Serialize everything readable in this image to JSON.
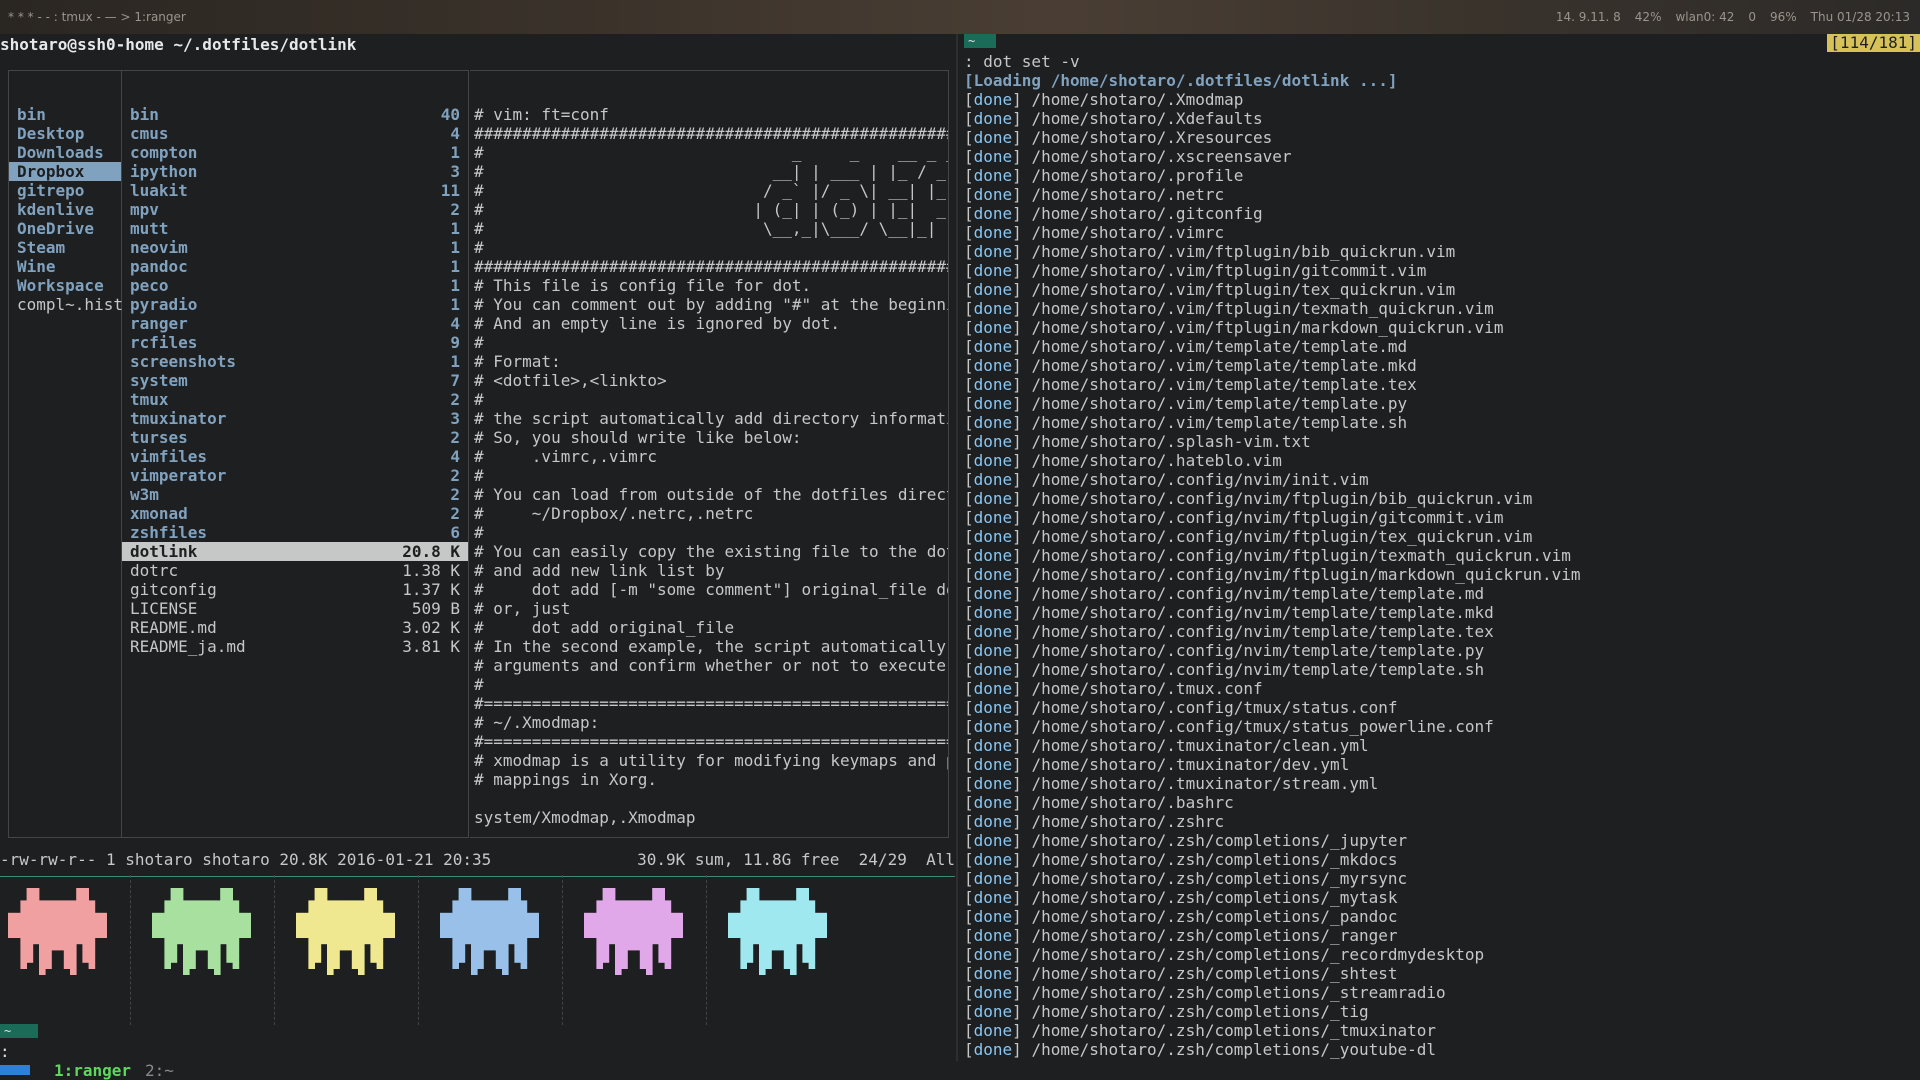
{
  "topbar": {
    "left": "* * * - - : tmux - — > 1:ranger",
    "right": [
      "14. 9.11. 8",
      "42%",
      "wlan0: 42",
      "0",
      "96%",
      "Thu 01/28 20:13"
    ]
  },
  "ranger": {
    "header_user": "shotaro@ssh0-home",
    "header_path": "~/.dotfiles/dotlink",
    "col1": [
      "bin",
      "Desktop",
      "Downloads",
      "Dropbox",
      "gitrepo",
      "kdenlive",
      "OneDrive",
      "Steam",
      "Wine",
      "Workspace",
      "compl~.hist"
    ],
    "col1_selected": "Dropbox",
    "col2": [
      {
        "name": "bin",
        "size": "40",
        "kind": "dir"
      },
      {
        "name": "cmus",
        "size": "4",
        "kind": "dir"
      },
      {
        "name": "compton",
        "size": "1",
        "kind": "dir"
      },
      {
        "name": "ipython",
        "size": "3",
        "kind": "dir"
      },
      {
        "name": "luakit",
        "size": "11",
        "kind": "dir"
      },
      {
        "name": "mpv",
        "size": "2",
        "kind": "dir"
      },
      {
        "name": "mutt",
        "size": "1",
        "kind": "dir"
      },
      {
        "name": "neovim",
        "size": "1",
        "kind": "dir"
      },
      {
        "name": "pandoc",
        "size": "1",
        "kind": "dir"
      },
      {
        "name": "peco",
        "size": "1",
        "kind": "dir"
      },
      {
        "name": "pyradio",
        "size": "1",
        "kind": "dir"
      },
      {
        "name": "ranger",
        "size": "4",
        "kind": "dir"
      },
      {
        "name": "rcfiles",
        "size": "9",
        "kind": "dir"
      },
      {
        "name": "screenshots",
        "size": "1",
        "kind": "dir"
      },
      {
        "name": "system",
        "size": "7",
        "kind": "dir"
      },
      {
        "name": "tmux",
        "size": "2",
        "kind": "dir"
      },
      {
        "name": "tmuxinator",
        "size": "3",
        "kind": "dir"
      },
      {
        "name": "turses",
        "size": "2",
        "kind": "dir"
      },
      {
        "name": "vimfiles",
        "size": "4",
        "kind": "dir"
      },
      {
        "name": "vimperator",
        "size": "2",
        "kind": "dir"
      },
      {
        "name": "w3m",
        "size": "2",
        "kind": "dir"
      },
      {
        "name": "xmonad",
        "size": "2",
        "kind": "dir"
      },
      {
        "name": "zshfiles",
        "size": "6",
        "kind": "dir"
      },
      {
        "name": "dotlink",
        "size": "20.8 K",
        "kind": "selected"
      },
      {
        "name": "dotrc",
        "size": "1.38 K",
        "kind": "file"
      },
      {
        "name": "gitconfig",
        "size": "1.37 K",
        "kind": "file"
      },
      {
        "name": "LICENSE",
        "size": "509 B",
        "kind": "file"
      },
      {
        "name": "README.md",
        "size": "3.02 K",
        "kind": "file"
      },
      {
        "name": "README_ja.md",
        "size": "3.81 K",
        "kind": "file"
      }
    ],
    "preview": [
      "# vim: ft=conf",
      "##################################################",
      "#                                _     _    __ _ _",
      "#                              __| | ___ | |_ / _(_) | ___",
      "#                             / _` |/ _ \\| __| |_| | |/ _ \\/",
      "#                            | (_| | (_) | |_|  _| | |  __/\\",
      "#                             \\__,_|\\___/ \\__|_| |_|_|\\___||",
      "#",
      "##################################################",
      "# This file is config file for dot.",
      "# You can comment out by adding \"#\" at the beginning",
      "# And an empty line is ignored by dot.",
      "#",
      "# Format:",
      "# <dotfile>,<linkto>",
      "#",
      "# the script automatically add directory information",
      "# So, you should write like below:",
      "#     .vimrc,.vimrc",
      "#",
      "# You can load from outside of the dotfiles director",
      "#     ~/Dropbox/.netrc,.netrc",
      "#",
      "# You can easily copy the existing file to the dotfi",
      "# and add new link list by",
      "#     dot add [-m \"some comment\"] original_file dotf",
      "# or, just",
      "#     dot add original_file",
      "# In the second example, the script automatically co",
      "# arguments and confirm whether or not to execute th",
      "#",
      "#==================================================",
      "# ~/.Xmodmap:",
      "#==================================================",
      "# xmodmap is a utility for modifying keymaps and poi",
      "# mappings in Xorg.",
      "",
      "system/Xmodmap,.Xmodmap"
    ],
    "status_left": "-rw-rw-r-- 1 shotaro shotaro 20.8K 2016-01-21 20:35",
    "status_right": "30.9K sum, 11.8G free  24/29  All"
  },
  "invaders": [
    {
      "color": "#f0a0a0"
    },
    {
      "color": "#a8e0a0"
    },
    {
      "color": "#f0e890"
    },
    {
      "color": "#98c0e8"
    },
    {
      "color": "#e0a8e8"
    },
    {
      "color": "#a0e8f0"
    }
  ],
  "bottom": {
    "tilde": "~",
    "prompt": ":",
    "window1": "1:ranger",
    "window2": "2:~"
  },
  "right": {
    "tilde": "~",
    "counter": "[114/181]",
    "command": ": dot set -v",
    "loading_prefix": "[Loading ",
    "loading_path": "/home/shotaro/.dotfiles/dotlink ...",
    "loading_suffix": "]",
    "done_label": "done",
    "entries": [
      "/home/shotaro/.Xmodmap",
      "/home/shotaro/.Xdefaults",
      "/home/shotaro/.Xresources",
      "/home/shotaro/.xscreensaver",
      "/home/shotaro/.profile",
      "/home/shotaro/.netrc",
      "/home/shotaro/.gitconfig",
      "/home/shotaro/.vimrc",
      "/home/shotaro/.vim/ftplugin/bib_quickrun.vim",
      "/home/shotaro/.vim/ftplugin/gitcommit.vim",
      "/home/shotaro/.vim/ftplugin/tex_quickrun.vim",
      "/home/shotaro/.vim/ftplugin/texmath_quickrun.vim",
      "/home/shotaro/.vim/ftplugin/markdown_quickrun.vim",
      "/home/shotaro/.vim/template/template.md",
      "/home/shotaro/.vim/template/template.mkd",
      "/home/shotaro/.vim/template/template.tex",
      "/home/shotaro/.vim/template/template.py",
      "/home/shotaro/.vim/template/template.sh",
      "/home/shotaro/.splash-vim.txt",
      "/home/shotaro/.hateblo.vim",
      "/home/shotaro/.config/nvim/init.vim",
      "/home/shotaro/.config/nvim/ftplugin/bib_quickrun.vim",
      "/home/shotaro/.config/nvim/ftplugin/gitcommit.vim",
      "/home/shotaro/.config/nvim/ftplugin/tex_quickrun.vim",
      "/home/shotaro/.config/nvim/ftplugin/texmath_quickrun.vim",
      "/home/shotaro/.config/nvim/ftplugin/markdown_quickrun.vim",
      "/home/shotaro/.config/nvim/template/template.md",
      "/home/shotaro/.config/nvim/template/template.mkd",
      "/home/shotaro/.config/nvim/template/template.tex",
      "/home/shotaro/.config/nvim/template/template.py",
      "/home/shotaro/.config/nvim/template/template.sh",
      "/home/shotaro/.tmux.conf",
      "/home/shotaro/.config/tmux/status.conf",
      "/home/shotaro/.config/tmux/status_powerline.conf",
      "/home/shotaro/.tmuxinator/clean.yml",
      "/home/shotaro/.tmuxinator/dev.yml",
      "/home/shotaro/.tmuxinator/stream.yml",
      "/home/shotaro/.bashrc",
      "/home/shotaro/.zshrc",
      "/home/shotaro/.zsh/completions/_jupyter",
      "/home/shotaro/.zsh/completions/_mkdocs",
      "/home/shotaro/.zsh/completions/_myrsync",
      "/home/shotaro/.zsh/completions/_mytask",
      "/home/shotaro/.zsh/completions/_pandoc",
      "/home/shotaro/.zsh/completions/_ranger",
      "/home/shotaro/.zsh/completions/_recordmydesktop",
      "/home/shotaro/.zsh/completions/_shtest",
      "/home/shotaro/.zsh/completions/_streamradio",
      "/home/shotaro/.zsh/completions/_tig",
      "/home/shotaro/.zsh/completions/_tmuxinator",
      "/home/shotaro/.zsh/completions/_youtube-dl"
    ]
  }
}
